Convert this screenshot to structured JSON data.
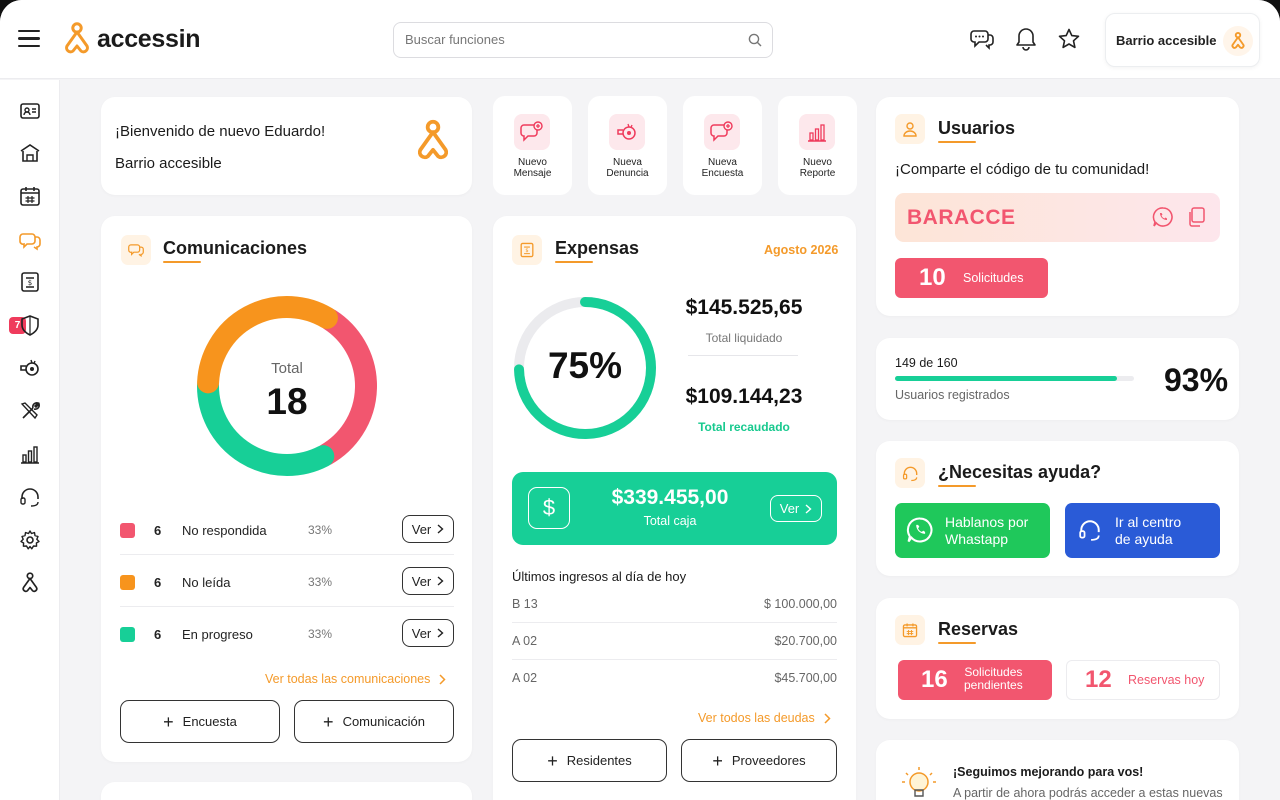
{
  "header": {
    "logo_text": "accessin",
    "search_placeholder": "Buscar funciones",
    "community_name": "Barrio accesible",
    "icons": [
      "menu-icon",
      "chat-icon",
      "bell-icon",
      "star-icon"
    ]
  },
  "sidebar": {
    "badge": "7",
    "items": [
      "id-card-icon",
      "building-icon",
      "calendar-icon",
      "chat-icon",
      "expense-doc-icon",
      "shield-icon",
      "whistle-icon",
      "tools-icon",
      "chart-icon",
      "headset-icon",
      "gear-icon",
      "accessin-icon"
    ]
  },
  "welcome": {
    "greeting": "¡Bienvenido de nuevo Eduardo!",
    "community": "Barrio accesible"
  },
  "quick_actions": [
    {
      "label1": "Nuevo",
      "label2": "Mensaje"
    },
    {
      "label1": "Nueva",
      "label2": "Denuncia"
    },
    {
      "label1": "Nueva",
      "label2": "Encuesta"
    },
    {
      "label1": "Nuevo",
      "label2": "Reporte"
    }
  ],
  "comunicaciones": {
    "title": "Comunicaciones",
    "total_label": "Total",
    "total": "18",
    "segments": [
      {
        "label": "No respondida",
        "count": "6",
        "pct": "33%",
        "value": 6,
        "color": "#f2566f"
      },
      {
        "label": "No leída",
        "count": "6",
        "pct": "33%",
        "value": 6,
        "color": "#f7941d"
      },
      {
        "label": "En progreso",
        "count": "6",
        "pct": "33%",
        "value": 6,
        "color": "#17cf97"
      }
    ],
    "ver_label": "Ver",
    "see_all": "Ver todas las comunicaciones",
    "btn_encuesta": "Encuesta",
    "btn_comunicacion": "Comunicación"
  },
  "expensas": {
    "title": "Expensas",
    "month": "Agosto 2026",
    "percent": "75%",
    "progress": 0.75,
    "liquidado_amount": "$145.525,65",
    "liquidado_label": "Total liquidado",
    "recaudado_amount": "$109.144,23",
    "recaudado_label": "Total recaudado",
    "caja_amount": "$339.455,00",
    "caja_label": "Total caja",
    "caja_icon": "$",
    "ver_label": "Ver",
    "income_title": "Últimos ingresos al día de hoy",
    "income": [
      {
        "unit": "B 13",
        "amount": "$ 100.000,00"
      },
      {
        "unit": "A 02",
        "amount": "$20.700,00"
      },
      {
        "unit": "A 02",
        "amount": "$45.700,00"
      }
    ],
    "see_debts": "Ver todos las deudas",
    "btn_residentes": "Residentes",
    "btn_proveedores": "Proveedores"
  },
  "usuarios": {
    "title": "Usuarios",
    "share_text": "¡Comparte el código de tu comunidad!",
    "code": "BARACCE",
    "requests_count": "10",
    "requests_label": "Solicitudes"
  },
  "registrados": {
    "count_text": "149 de 160",
    "label": "Usuarios registrados",
    "percent": "93%",
    "progress": 0.93
  },
  "ayuda": {
    "title": "¿Necesitas ayuda?",
    "whatsapp_line1": "Hablanos por",
    "whatsapp_line2": "Whastapp",
    "help_line1": "Ir al centro",
    "help_line2": "de ayuda"
  },
  "reservas": {
    "title": "Reservas",
    "pending_count": "16",
    "pending_line1": "Solicitudes",
    "pending_line2": "pendientes",
    "today_count": "12",
    "today_label": "Reservas hoy"
  },
  "news": {
    "title": "¡Seguimos mejorando para vos!",
    "text": "A partir de ahora podrás acceder a estas nuevas"
  },
  "colors": {
    "orange": "#f49a2a",
    "pink": "#f2566f",
    "green": "#17cf97",
    "blue": "#2a5bd7",
    "whatsapp_green": "#1fc85b"
  }
}
